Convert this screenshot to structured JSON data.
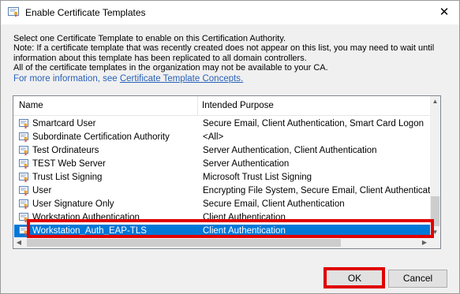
{
  "window": {
    "title": "Enable Certificate Templates",
    "close_glyph": "✕"
  },
  "description": {
    "line1": "Select one Certificate Template to enable on this Certification Authority.",
    "line2": "Note: If a certificate template that was recently created does not appear on this list, you may need to wait until",
    "line3": "information about this template has been replicated to all domain controllers.",
    "line4": "All of the certificate templates in the organization may not be available to your CA.",
    "link_prefix": "For more information, see ",
    "link_text": "Certificate Template Concepts."
  },
  "list": {
    "columns": [
      "Name",
      "Intended Purpose"
    ],
    "rows": [
      {
        "name": "Smartcard User",
        "purpose": "Secure Email, Client Authentication, Smart Card Logon",
        "selected": false
      },
      {
        "name": "Subordinate Certification Authority",
        "purpose": "<All>",
        "selected": false
      },
      {
        "name": "Test Ordinateurs",
        "purpose": "Server Authentication, Client Authentication",
        "selected": false
      },
      {
        "name": "TEST Web Server",
        "purpose": "Server Authentication",
        "selected": false
      },
      {
        "name": "Trust List Signing",
        "purpose": "Microsoft Trust List Signing",
        "selected": false
      },
      {
        "name": "User",
        "purpose": "Encrypting File System, Secure Email, Client Authentication",
        "selected": false
      },
      {
        "name": "User Signature Only",
        "purpose": "Secure Email, Client Authentication",
        "selected": false
      },
      {
        "name": "Workstation Authentication",
        "purpose": "Client Authentication",
        "selected": false
      },
      {
        "name": "Workstation_Auth_EAP-TLS",
        "purpose": "Client Authentication",
        "selected": true
      }
    ]
  },
  "buttons": {
    "ok": "OK",
    "cancel": "Cancel"
  },
  "colors": {
    "selection": "#0078d7",
    "highlight": "#e00000",
    "link": "#2a62b9"
  },
  "icons": {
    "title": "certificate-icon",
    "row": "certificate-template-icon"
  }
}
